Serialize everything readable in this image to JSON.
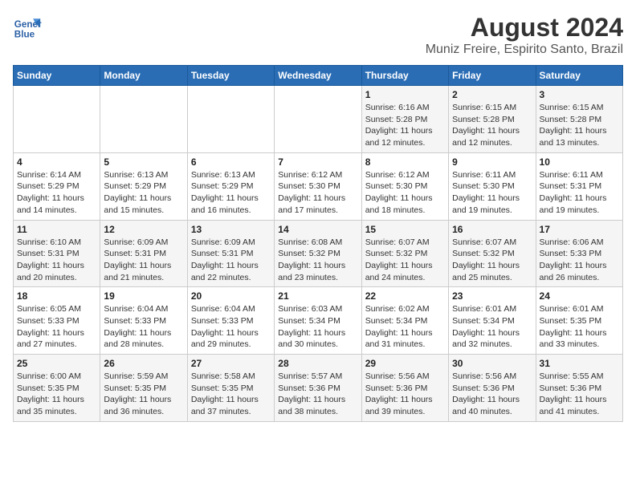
{
  "header": {
    "logo_line1": "General",
    "logo_line2": "Blue",
    "month_year": "August 2024",
    "location": "Muniz Freire, Espirito Santo, Brazil"
  },
  "weekdays": [
    "Sunday",
    "Monday",
    "Tuesday",
    "Wednesday",
    "Thursday",
    "Friday",
    "Saturday"
  ],
  "weeks": [
    [
      {
        "day": "",
        "sunrise": "",
        "sunset": "",
        "daylight": ""
      },
      {
        "day": "",
        "sunrise": "",
        "sunset": "",
        "daylight": ""
      },
      {
        "day": "",
        "sunrise": "",
        "sunset": "",
        "daylight": ""
      },
      {
        "day": "",
        "sunrise": "",
        "sunset": "",
        "daylight": ""
      },
      {
        "day": "1",
        "sunrise": "6:16 AM",
        "sunset": "5:28 PM",
        "daylight": "11 hours and 12 minutes."
      },
      {
        "day": "2",
        "sunrise": "6:15 AM",
        "sunset": "5:28 PM",
        "daylight": "11 hours and 12 minutes."
      },
      {
        "day": "3",
        "sunrise": "6:15 AM",
        "sunset": "5:28 PM",
        "daylight": "11 hours and 13 minutes."
      }
    ],
    [
      {
        "day": "4",
        "sunrise": "6:14 AM",
        "sunset": "5:29 PM",
        "daylight": "11 hours and 14 minutes."
      },
      {
        "day": "5",
        "sunrise": "6:13 AM",
        "sunset": "5:29 PM",
        "daylight": "11 hours and 15 minutes."
      },
      {
        "day": "6",
        "sunrise": "6:13 AM",
        "sunset": "5:29 PM",
        "daylight": "11 hours and 16 minutes."
      },
      {
        "day": "7",
        "sunrise": "6:12 AM",
        "sunset": "5:30 PM",
        "daylight": "11 hours and 17 minutes."
      },
      {
        "day": "8",
        "sunrise": "6:12 AM",
        "sunset": "5:30 PM",
        "daylight": "11 hours and 18 minutes."
      },
      {
        "day": "9",
        "sunrise": "6:11 AM",
        "sunset": "5:30 PM",
        "daylight": "11 hours and 19 minutes."
      },
      {
        "day": "10",
        "sunrise": "6:11 AM",
        "sunset": "5:31 PM",
        "daylight": "11 hours and 19 minutes."
      }
    ],
    [
      {
        "day": "11",
        "sunrise": "6:10 AM",
        "sunset": "5:31 PM",
        "daylight": "11 hours and 20 minutes."
      },
      {
        "day": "12",
        "sunrise": "6:09 AM",
        "sunset": "5:31 PM",
        "daylight": "11 hours and 21 minutes."
      },
      {
        "day": "13",
        "sunrise": "6:09 AM",
        "sunset": "5:31 PM",
        "daylight": "11 hours and 22 minutes."
      },
      {
        "day": "14",
        "sunrise": "6:08 AM",
        "sunset": "5:32 PM",
        "daylight": "11 hours and 23 minutes."
      },
      {
        "day": "15",
        "sunrise": "6:07 AM",
        "sunset": "5:32 PM",
        "daylight": "11 hours and 24 minutes."
      },
      {
        "day": "16",
        "sunrise": "6:07 AM",
        "sunset": "5:32 PM",
        "daylight": "11 hours and 25 minutes."
      },
      {
        "day": "17",
        "sunrise": "6:06 AM",
        "sunset": "5:33 PM",
        "daylight": "11 hours and 26 minutes."
      }
    ],
    [
      {
        "day": "18",
        "sunrise": "6:05 AM",
        "sunset": "5:33 PM",
        "daylight": "11 hours and 27 minutes."
      },
      {
        "day": "19",
        "sunrise": "6:04 AM",
        "sunset": "5:33 PM",
        "daylight": "11 hours and 28 minutes."
      },
      {
        "day": "20",
        "sunrise": "6:04 AM",
        "sunset": "5:33 PM",
        "daylight": "11 hours and 29 minutes."
      },
      {
        "day": "21",
        "sunrise": "6:03 AM",
        "sunset": "5:34 PM",
        "daylight": "11 hours and 30 minutes."
      },
      {
        "day": "22",
        "sunrise": "6:02 AM",
        "sunset": "5:34 PM",
        "daylight": "11 hours and 31 minutes."
      },
      {
        "day": "23",
        "sunrise": "6:01 AM",
        "sunset": "5:34 PM",
        "daylight": "11 hours and 32 minutes."
      },
      {
        "day": "24",
        "sunrise": "6:01 AM",
        "sunset": "5:35 PM",
        "daylight": "11 hours and 33 minutes."
      }
    ],
    [
      {
        "day": "25",
        "sunrise": "6:00 AM",
        "sunset": "5:35 PM",
        "daylight": "11 hours and 35 minutes."
      },
      {
        "day": "26",
        "sunrise": "5:59 AM",
        "sunset": "5:35 PM",
        "daylight": "11 hours and 36 minutes."
      },
      {
        "day": "27",
        "sunrise": "5:58 AM",
        "sunset": "5:35 PM",
        "daylight": "11 hours and 37 minutes."
      },
      {
        "day": "28",
        "sunrise": "5:57 AM",
        "sunset": "5:36 PM",
        "daylight": "11 hours and 38 minutes."
      },
      {
        "day": "29",
        "sunrise": "5:56 AM",
        "sunset": "5:36 PM",
        "daylight": "11 hours and 39 minutes."
      },
      {
        "day": "30",
        "sunrise": "5:56 AM",
        "sunset": "5:36 PM",
        "daylight": "11 hours and 40 minutes."
      },
      {
        "day": "31",
        "sunrise": "5:55 AM",
        "sunset": "5:36 PM",
        "daylight": "11 hours and 41 minutes."
      }
    ]
  ]
}
